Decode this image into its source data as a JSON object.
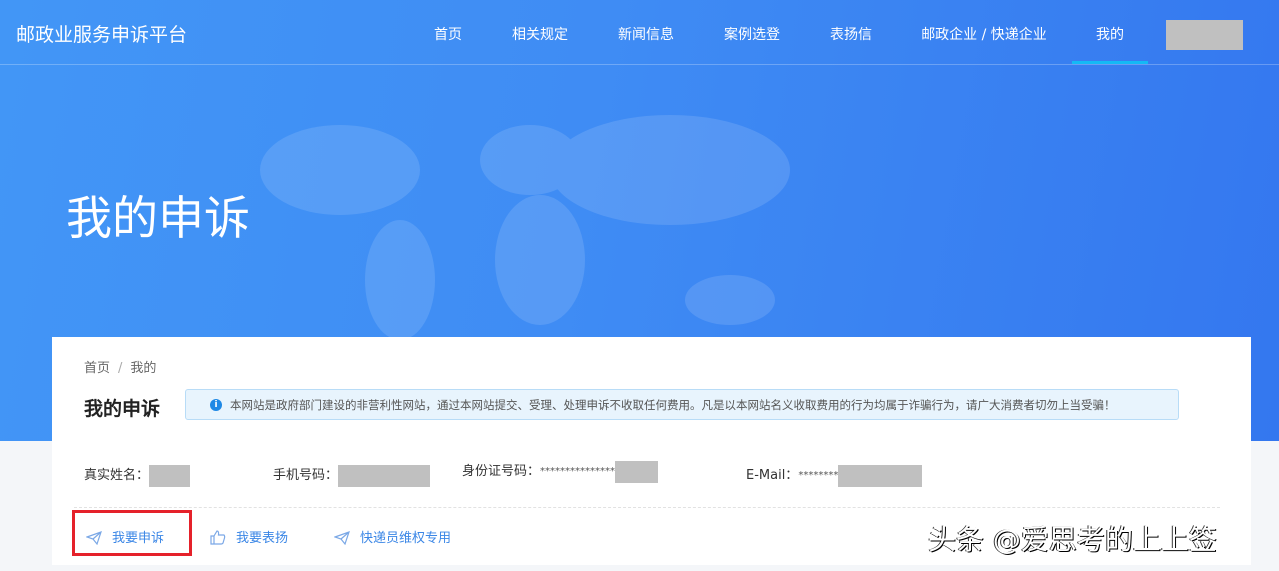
{
  "nav": {
    "logo": "邮政业服务申诉平台",
    "items": [
      "首页",
      "相关规定",
      "新闻信息",
      "案例选登",
      "表扬信",
      "邮政企业 / 快递企业",
      "我的"
    ],
    "active": "我的"
  },
  "hero": {
    "title": "我的申诉"
  },
  "breadcrumb": [
    "首页",
    "我的"
  ],
  "page_title": "我的申诉",
  "notice": "本网站是政府部门建设的非营利性网站，通过本网站提交、受理、处理申诉不收取任何费用。凡是以本网站名义收取费用的行为均属于诈骗行为，请广大消费者切勿上当受骗！",
  "fields": {
    "name_label": "真实姓名：",
    "phone_label": "手机号码：",
    "id_label": "身份证号码：",
    "id_value": "***************",
    "email_label": "E-Mail：",
    "email_value": "********"
  },
  "actions": [
    "我要申诉",
    "我要表扬",
    "快递员维权专用"
  ],
  "watermark": "头条 @爱思考的上上签",
  "colors": {
    "primary": "#3f8cf4",
    "accent": "#14b9f5",
    "link": "#3a86e6",
    "highlight": "#e5212a"
  }
}
